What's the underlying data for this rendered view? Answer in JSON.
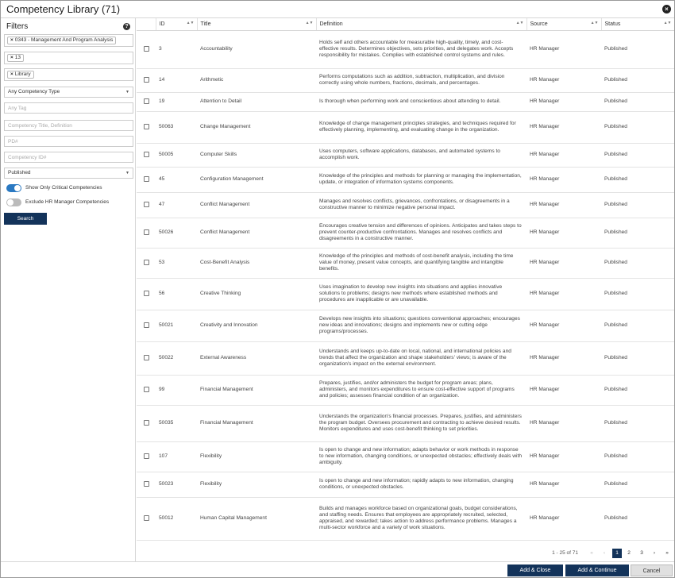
{
  "window": {
    "title": "Competency Library (71)",
    "close_icon": "×"
  },
  "filters": {
    "heading": "Filters",
    "help_icon": "?",
    "chips": [
      "0343 - Management And Program Analysis",
      "13",
      "Library"
    ],
    "chip_remove": "×",
    "competency_type": "Any Competency Type",
    "tag_placeholder": "Any Tag",
    "title_placeholder": "Competency Title, Definition",
    "pd_placeholder": "PD#",
    "id_placeholder": "Competency ID#",
    "status": "Published",
    "toggle_critical": {
      "label": "Show Only Critical Competencies",
      "on": true
    },
    "toggle_exclude_hr": {
      "label": "Exclude HR Manager Competencies",
      "on": false
    },
    "search_label": "Search"
  },
  "table": {
    "columns": {
      "id": "ID",
      "title": "Title",
      "definition": "Definition",
      "source": "Source",
      "status": "Status"
    },
    "rows": [
      {
        "id": "3",
        "title": "Accountability",
        "definition": "Holds self and others accountable for measurable high-quality, timely, and cost-effective results. Determines objectives, sets priorities, and delegates work. Accepts responsibility for mistakes. Complies with established control systems and rules.",
        "source": "HR Manager",
        "status": "Published"
      },
      {
        "id": "14",
        "title": "Arithmetic",
        "definition": "Performs computations such as addition, subtraction, multiplication, and division correctly using whole numbers, fractions, decimals, and percentages.",
        "source": "HR Manager",
        "status": "Published"
      },
      {
        "id": "19",
        "title": "Attention to Detail",
        "definition": "Is thorough when performing work and conscientious about attending to detail.",
        "source": "HR Manager",
        "status": "Published"
      },
      {
        "id": "50063",
        "title": "Change Management",
        "definition": "Knowledge of change management principles strategies, and techniques required for effectively planning, implementing, and evaluating change in the organization.",
        "source": "HR Manager",
        "status": "Published"
      },
      {
        "id": "50005",
        "title": "Computer Skills",
        "definition": "Uses computers, software applications, databases, and automated systems to accomplish work.",
        "source": "HR Manager",
        "status": "Published"
      },
      {
        "id": "45",
        "title": "Configuration Management",
        "definition": "Knowledge of the principles and methods for planning or managing the implementation, update, or integration of information systems components.",
        "source": "HR Manager",
        "status": "Published"
      },
      {
        "id": "47",
        "title": "Conflict Management",
        "definition": "Manages and resolves conflicts, grievances, confrontations, or disagreements in a constructive manner to minimize negative personal impact.",
        "source": "HR Manager",
        "status": "Published"
      },
      {
        "id": "50026",
        "title": "Conflict Management",
        "definition": "Encourages creative tension and differences of opinions. Anticipates and takes steps to prevent counter-productive confrontations. Manages and resolves conflicts and disagreements in a constructive manner.",
        "source": "HR Manager",
        "status": "Published"
      },
      {
        "id": "53",
        "title": "Cost-Benefit Analysis",
        "definition": "Knowledge of the principles and methods of cost-benefit analysis, including the time value of money, present value concepts, and quantifying tangible and intangible benefits.",
        "source": "HR Manager",
        "status": "Published"
      },
      {
        "id": "56",
        "title": "Creative Thinking",
        "definition": "Uses imagination to develop new insights into situations and applies innovative solutions to problems; designs new methods where established methods and procedures are inapplicable or are unavailable.",
        "source": "HR Manager",
        "status": "Published"
      },
      {
        "id": "50021",
        "title": "Creativity and Innovation",
        "definition": "Develops new insights into situations; questions conventional approaches; encourages new ideas and innovations; designs and implements new or cutting edge programs/processes.",
        "source": "HR Manager",
        "status": "Published"
      },
      {
        "id": "50022",
        "title": "External Awareness",
        "definition": "Understands and keeps up-to-date on local, national, and international policies and trends that affect the organization and shape stakeholders' views; is aware of the organization's impact on the external environment.",
        "source": "HR Manager",
        "status": "Published"
      },
      {
        "id": "99",
        "title": "Financial Management",
        "definition": "Prepares, justifies, and/or administers the budget for program areas; plans, administers, and monitors expenditures to ensure cost-effective support of programs and policies; assesses financial condition of an organization.",
        "source": "HR Manager",
        "status": "Published"
      },
      {
        "id": "50035",
        "title": "Financial Management",
        "definition": "Understands the organization's financial processes. Prepares, justifies, and administers the program budget. Oversees procurement and contracting to achieve desired results. Monitors expenditures and uses cost-benefit thinking to set priorities.",
        "source": "HR Manager",
        "status": "Published"
      },
      {
        "id": "107",
        "title": "Flexibility",
        "definition": "Is open to change and new information; adapts behavior or work methods in response to new information, changing conditions, or unexpected obstacles; effectively deals with ambiguity.",
        "source": "HR Manager",
        "status": "Published"
      },
      {
        "id": "50023",
        "title": "Flexibility",
        "definition": "Is open to change and new information; rapidly adapts to new information, changing conditions, or unexpected obstacles.",
        "source": "HR Manager",
        "status": "Published"
      },
      {
        "id": "50012",
        "title": "Human Capital Management",
        "definition": "Builds and manages workforce based on organizational goals, budget considerations, and staffing needs. Ensures that employees are appropriately recruited, selected, appraised, and rewarded; takes action to address performance problems. Manages a multi-sector workforce and a variety of work situations.",
        "source": "HR Manager",
        "status": "Published"
      }
    ]
  },
  "pager": {
    "info": "1 - 25 of 71",
    "first": "«",
    "prev": "‹",
    "pages": [
      "1",
      "2",
      "3"
    ],
    "next": "›",
    "last": "»",
    "active_page": "1"
  },
  "footer": {
    "add_close": "Add & Close",
    "add_continue": "Add & Continue",
    "cancel": "Cancel"
  },
  "colors": {
    "primary": "#13335a",
    "toggle_on": "#2a79c2"
  }
}
